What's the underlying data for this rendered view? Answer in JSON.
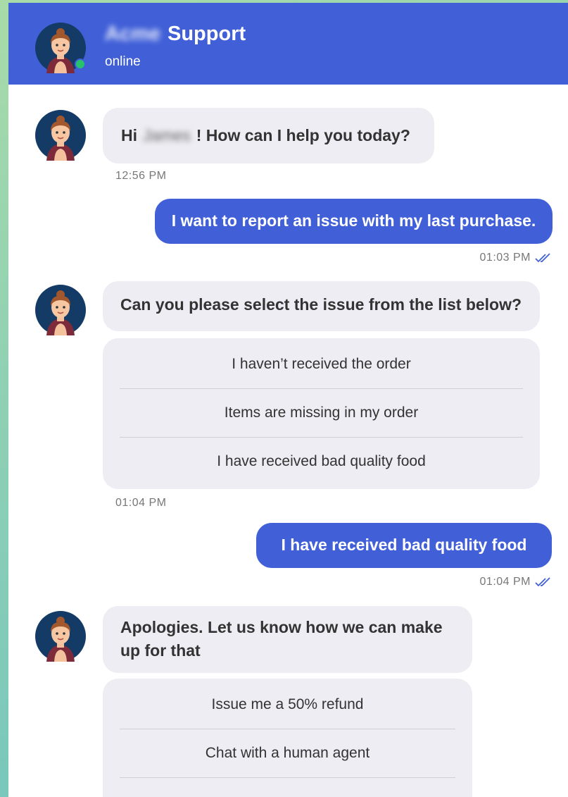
{
  "header": {
    "brand_blurred": "Acme",
    "title": "Support",
    "status": "online"
  },
  "messages": {
    "m1": {
      "greeting_prefix": "Hi",
      "name_blurred": "James",
      "greeting_suffix": "! How can I help you today?",
      "time": "12:56 PM"
    },
    "m2": {
      "text": "I want to report an issue with my last purchase.",
      "time": "01:03 PM"
    },
    "m3": {
      "text": "Can you please select the issue from the list below?",
      "time": "01:04 PM",
      "options": [
        "I haven’t received the order",
        "Items are missing in my order",
        "I have received bad quality food"
      ]
    },
    "m4": {
      "text": "I have received bad quality food",
      "time": "01:04 PM"
    },
    "m5": {
      "text": "Apologies. Let us know how we can make up for that",
      "options": [
        "Issue me a 50% refund",
        "Chat with a human agent"
      ]
    }
  },
  "colors": {
    "header": "#4160d8",
    "online": "#27c26c",
    "outgoing": "#4160d8",
    "incoming": "#ededf3"
  },
  "icons": {
    "avatar": "agent-avatar-icon",
    "read": "double-check-icon"
  }
}
